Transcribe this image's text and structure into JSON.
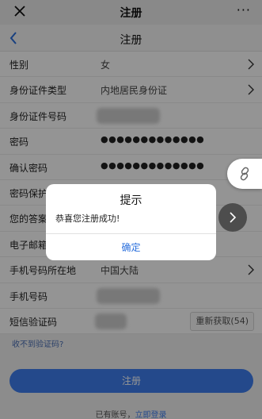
{
  "topbar": {
    "title": "注册",
    "close_icon": "close-icon",
    "more_label": "···"
  },
  "navbar": {
    "title": "注册",
    "back_icon": "chevron-left-icon"
  },
  "form": {
    "rows": [
      {
        "label": "性别",
        "value": "女"
      },
      {
        "label": "身份证件类型",
        "value": "内地居民身份证"
      },
      {
        "label": "身份证件号码"
      },
      {
        "label": "密码",
        "value": "●●●●●●●●●●●●●"
      },
      {
        "label": "确认密码",
        "value": "●●●●●●●●●●●●●"
      },
      {
        "label": "密码保护问题"
      },
      {
        "label": "您的答案"
      },
      {
        "label": "电子邮箱"
      },
      {
        "label": "手机号码所在地",
        "value": "中国大陆"
      },
      {
        "label": "手机号码"
      },
      {
        "label": "短信验证码",
        "resend": "重新获取(54)"
      }
    ]
  },
  "no_code_link": "收不到验证码?",
  "register_button": "注册",
  "login": {
    "prompt": "已有账号，",
    "link": "立即登录"
  },
  "dialog": {
    "title": "提示",
    "message": "恭喜您注册成功!",
    "confirm": "确定"
  },
  "colors": {
    "accent": "#3e7ff0",
    "overlay": "rgba(0,0,0,0.42)"
  }
}
